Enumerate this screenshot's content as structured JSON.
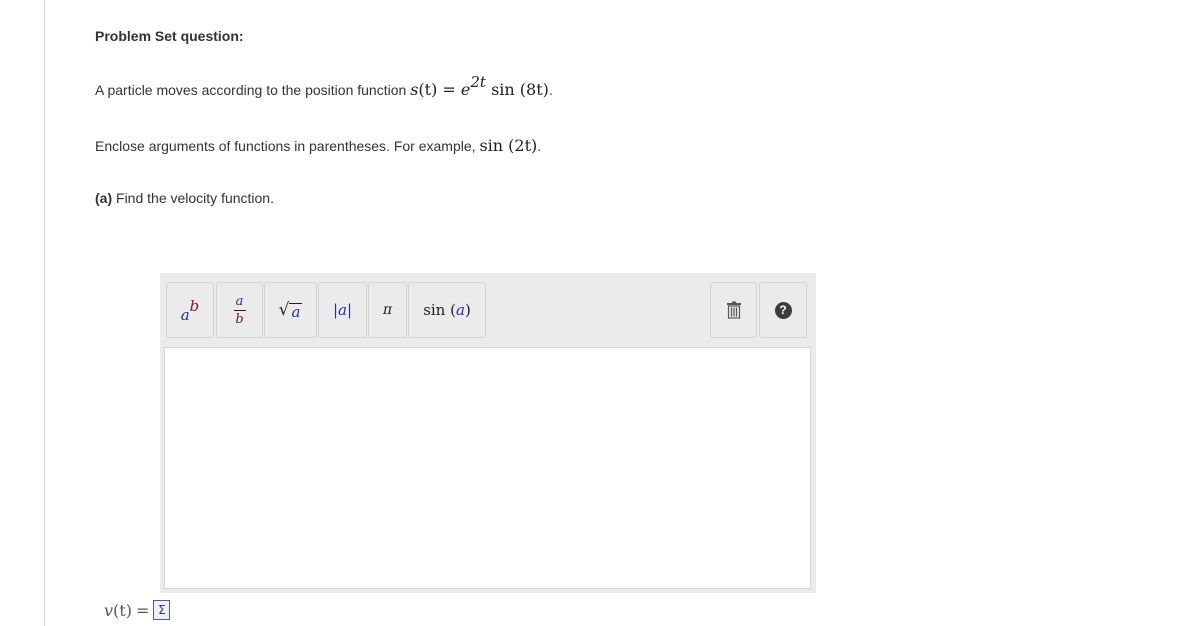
{
  "heading": "Problem Set question:",
  "intro": {
    "text": "A particle moves according to the position function ",
    "lhs_var": "s",
    "lhs_arg": "(t)",
    "equals": "=",
    "base": "e",
    "exponent": "2t",
    "fn": "sin",
    "fn_arg": "(8t)",
    "end": "."
  },
  "instruction": {
    "text": "Enclose arguments of functions in parentheses. For example, ",
    "fn": "sin",
    "fn_arg": "(2t)",
    "end": "."
  },
  "part_a": {
    "label": "(a)",
    "text": " Find the velocity function."
  },
  "toolbar": {
    "power_base": "a",
    "power_exp": "b",
    "frac_num": "a",
    "frac_den": "b",
    "sqrt_sym": "√",
    "sqrt_arg": "a",
    "abs_label": "|a|",
    "pi_label": "π",
    "sin_fn": "sin",
    "sin_open": "(",
    "sin_arg": "a",
    "sin_close": ")",
    "help_label": "?"
  },
  "answer": {
    "var": "v",
    "arg": "(t)",
    "equals": "=",
    "icon_symbol": "Σ"
  },
  "icons": [
    "power-template-icon",
    "fraction-template-icon",
    "sqrt-template-icon",
    "abs-template-icon",
    "pi-icon",
    "sin-template-icon",
    "trash-icon",
    "help-icon",
    "equation-editor-icon"
  ]
}
